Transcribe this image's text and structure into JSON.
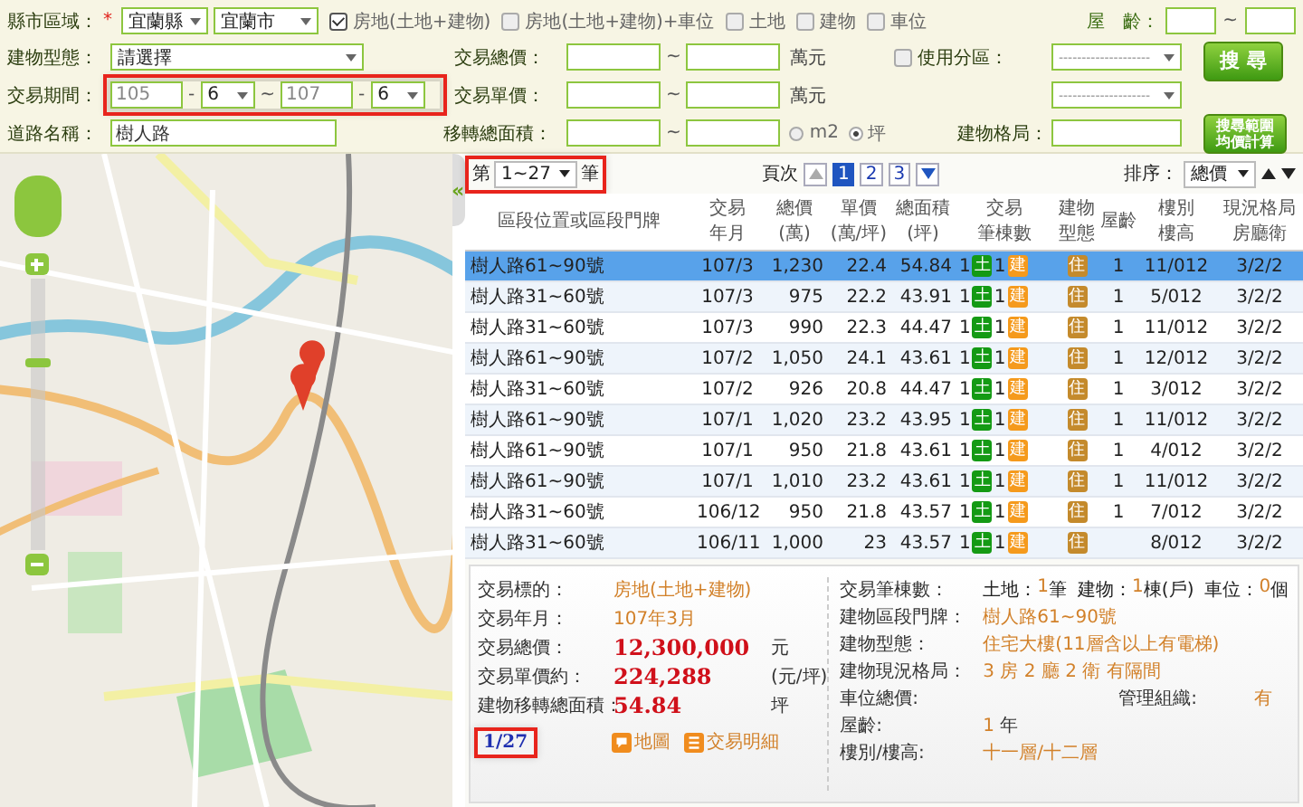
{
  "filters": {
    "region": {
      "label": "縣市區域：",
      "required": "*",
      "county": "宜蘭縣",
      "city": "宜蘭市"
    },
    "types": [
      {
        "label": "房地(土地+建物)",
        "checked": true
      },
      {
        "label": "房地(土地+建物)+車位",
        "checked": false
      },
      {
        "label": "土地",
        "checked": false
      },
      {
        "label": "建物",
        "checked": false
      },
      {
        "label": "車位",
        "checked": false
      }
    ],
    "age": {
      "label": "屋　齡：",
      "sep": "~"
    },
    "building_type": {
      "label": "建物型態：",
      "value": "請選擇"
    },
    "total_price": {
      "label": "交易總價：",
      "sep": "~",
      "unit": "萬元"
    },
    "zoning": {
      "label": "使用分區：",
      "checked": false,
      "placeholder": "--------------------"
    },
    "zoning2": {
      "placeholder": "--------------------"
    },
    "search_button": "搜尋",
    "period": {
      "label": "交易期間：",
      "from_year": "105",
      "from_month": "6",
      "to_year": "107",
      "to_month": "6",
      "dash": "-",
      "sep": "~",
      "highlighted": true
    },
    "unit_price": {
      "label": "交易單價：",
      "sep": "~",
      "unit": "萬元"
    },
    "road": {
      "label": "道路名稱：",
      "value": "樹人路"
    },
    "area": {
      "label": "移轉總面積：",
      "sep": "~",
      "units": [
        {
          "label": "m2",
          "selected": false
        },
        {
          "label": "坪",
          "selected": true
        }
      ]
    },
    "layout": {
      "label": "建物格局："
    },
    "avg_button": [
      "搜尋範圍",
      "均價計算"
    ]
  },
  "collapse": "«",
  "map_zoom": {
    "level": 0.7
  },
  "list": {
    "count": {
      "prefix": "第",
      "value": "1~27",
      "suffix": "筆",
      "highlighted": true
    },
    "pager": {
      "label": "頁次",
      "pages": [
        {
          "label": "1",
          "selected": true
        },
        {
          "label": "2",
          "selected": false
        },
        {
          "label": "3",
          "selected": false
        }
      ]
    },
    "sort": {
      "label": "排序：",
      "value": "總價"
    },
    "columns": [
      {
        "lines": [
          "區段位置或區段門牌"
        ]
      },
      {
        "lines": [
          "交易",
          "年月"
        ]
      },
      {
        "lines": [
          "總價",
          "(萬)"
        ]
      },
      {
        "lines": [
          "單價",
          "(萬/坪)"
        ]
      },
      {
        "lines": [
          "總面積",
          "(坪)"
        ]
      },
      {
        "lines": [
          "交易",
          "筆棟數"
        ]
      },
      {
        "lines": [
          "建物",
          "型態"
        ]
      },
      {
        "lines": [
          "屋齡"
        ]
      },
      {
        "lines": [
          "樓別",
          "樓高"
        ]
      },
      {
        "lines": [
          "現況格局",
          "房廳衛"
        ]
      }
    ],
    "rows": [
      {
        "address": "樹人路61~90號",
        "date": "107/3",
        "total": "1,230",
        "unit": "22.4",
        "area": "54.84",
        "land": "1",
        "land_badge": "土",
        "bldg": "1",
        "bldg_badge": "建",
        "type": "住",
        "age": "1",
        "floor": "11/012",
        "layout": "3/2/2",
        "selected": true
      },
      {
        "address": "樹人路31~60號",
        "date": "107/3",
        "total": "975",
        "unit": "22.2",
        "area": "43.91",
        "land": "1",
        "land_badge": "土",
        "bldg": "1",
        "bldg_badge": "建",
        "type": "住",
        "age": "1",
        "floor": "5/012",
        "layout": "3/2/2",
        "selected": false
      },
      {
        "address": "樹人路31~60號",
        "date": "107/3",
        "total": "990",
        "unit": "22.3",
        "area": "44.47",
        "land": "1",
        "land_badge": "土",
        "bldg": "1",
        "bldg_badge": "建",
        "type": "住",
        "age": "1",
        "floor": "11/012",
        "layout": "3/2/2",
        "selected": false
      },
      {
        "address": "樹人路61~90號",
        "date": "107/2",
        "total": "1,050",
        "unit": "24.1",
        "area": "43.61",
        "land": "1",
        "land_badge": "土",
        "bldg": "1",
        "bldg_badge": "建",
        "type": "住",
        "age": "1",
        "floor": "12/012",
        "layout": "3/2/2",
        "selected": false
      },
      {
        "address": "樹人路31~60號",
        "date": "107/2",
        "total": "926",
        "unit": "20.8",
        "area": "44.47",
        "land": "1",
        "land_badge": "土",
        "bldg": "1",
        "bldg_badge": "建",
        "type": "住",
        "age": "1",
        "floor": "3/012",
        "layout": "3/2/2",
        "selected": false
      },
      {
        "address": "樹人路61~90號",
        "date": "107/1",
        "total": "1,020",
        "unit": "23.2",
        "area": "43.95",
        "land": "1",
        "land_badge": "土",
        "bldg": "1",
        "bldg_badge": "建",
        "type": "住",
        "age": "1",
        "floor": "11/012",
        "layout": "3/2/2",
        "selected": false
      },
      {
        "address": "樹人路61~90號",
        "date": "107/1",
        "total": "950",
        "unit": "21.8",
        "area": "43.61",
        "land": "1",
        "land_badge": "土",
        "bldg": "1",
        "bldg_badge": "建",
        "type": "住",
        "age": "1",
        "floor": "4/012",
        "layout": "3/2/2",
        "selected": false
      },
      {
        "address": "樹人路61~90號",
        "date": "107/1",
        "total": "1,010",
        "unit": "23.2",
        "area": "43.61",
        "land": "1",
        "land_badge": "土",
        "bldg": "1",
        "bldg_badge": "建",
        "type": "住",
        "age": "1",
        "floor": "11/012",
        "layout": "3/2/2",
        "selected": false
      },
      {
        "address": "樹人路31~60號",
        "date": "106/12",
        "total": "950",
        "unit": "21.8",
        "area": "43.57",
        "land": "1",
        "land_badge": "土",
        "bldg": "1",
        "bldg_badge": "建",
        "type": "住",
        "age": "1",
        "floor": "7/012",
        "layout": "3/2/2",
        "selected": false
      },
      {
        "address": "樹人路31~60號",
        "date": "106/11",
        "total": "1,000",
        "unit": "23",
        "area": "43.57",
        "land": "1",
        "land_badge": "土",
        "bldg": "1",
        "bldg_badge": "建",
        "type": "住",
        "floor": "8/012",
        "layout": "3/2/2",
        "selected": false
      }
    ]
  },
  "detail": {
    "left": [
      {
        "label": "交易標的：",
        "value": "房地(土地+建物)",
        "kind": "plain"
      },
      {
        "label": "交易年月：",
        "value": "107年3月",
        "kind": "plain"
      },
      {
        "label": "交易總價：",
        "value": "12,300,000",
        "unit": "元",
        "kind": "emphasis"
      },
      {
        "label": "交易單價約：",
        "value": "224,288",
        "unit": "(元/坪)",
        "kind": "emphasis"
      },
      {
        "label": "建物移轉總面積：",
        "value": "54.84",
        "unit": "坪",
        "kind": "emphasis"
      }
    ],
    "position": {
      "text": "1/27",
      "highlighted": true
    },
    "links": [
      {
        "label": "地圖",
        "kind": "map"
      },
      {
        "label": "交易明細",
        "kind": "list"
      }
    ],
    "counts": {
      "label": "交易筆棟數：",
      "parts": [
        {
          "label": "土地：",
          "value": "1",
          "unit": "筆"
        },
        {
          "label": "建物：",
          "value": "1",
          "unit": "棟(戶)"
        },
        {
          "label": "車位：",
          "value": "0",
          "unit": "個"
        }
      ]
    },
    "right": [
      {
        "label": "建物區段門牌：",
        "value": "樹人路61~90號"
      },
      {
        "label": "建物型態：",
        "value": "住宅大樓(11層含以上有電梯)"
      },
      {
        "label": "建物現況格局：",
        "value": "3 房 2 廳 2 衛 有隔間"
      }
    ],
    "parking": {
      "label": "車位總價:",
      "mgmt_label": "管理組織:",
      "mgmt_value": "有"
    },
    "right2": [
      {
        "label": "屋齡:",
        "value": "1",
        "unit": "年"
      },
      {
        "label": "樓別/樓高:",
        "value": "十一層/十二層"
      }
    ]
  }
}
